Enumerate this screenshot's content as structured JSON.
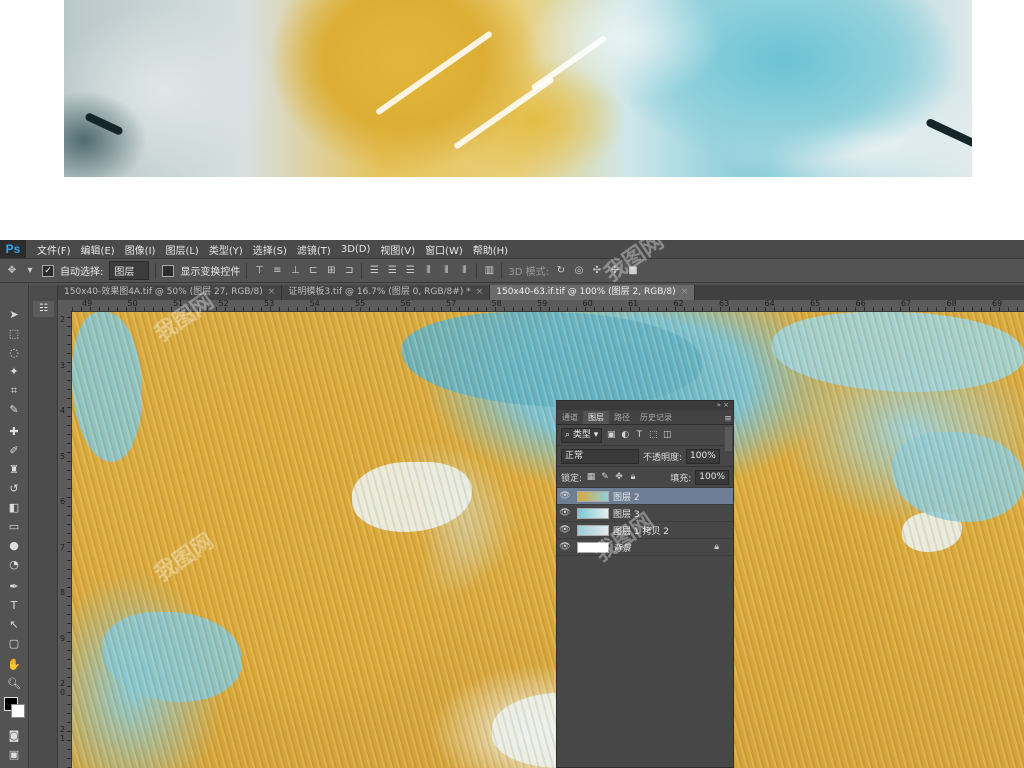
{
  "app": {
    "logo": "Ps"
  },
  "menu": [
    "文件(F)",
    "编辑(E)",
    "图像(I)",
    "图层(L)",
    "类型(Y)",
    "选择(S)",
    "滤镜(T)",
    "3D(D)",
    "视图(V)",
    "窗口(W)",
    "帮助(H)"
  ],
  "options": {
    "auto_select_label": "自动选择:",
    "auto_select_value": "图层",
    "show_transform_label": "显示变换控件",
    "mode_3d_label": "3D 模式:"
  },
  "tabs": [
    {
      "label": "150x40-效果图4A.tif @ 50% (图层 27, RGB/8)",
      "close": "×"
    },
    {
      "label": "证明模板3.tif @ 16.7% (图层 0, RGB/8#) *",
      "close": "×"
    },
    {
      "label": "150x40-63.if.tif @ 100% (图层 2, RGB/8)",
      "close": "×"
    }
  ],
  "ruler_top": [
    "49",
    "50",
    "51",
    "52",
    "53",
    "54",
    "55",
    "56",
    "57",
    "58",
    "59",
    "60",
    "61",
    "62",
    "63",
    "64",
    "65",
    "66",
    "67",
    "68",
    "69",
    "70"
  ],
  "ruler_left": [
    "2",
    "3",
    "4",
    "5",
    "6",
    "7",
    "8",
    "9",
    "2 0",
    "2 1"
  ],
  "layers_panel": {
    "tabs": [
      "通道",
      "图层",
      "路径",
      "历史记录"
    ],
    "kind_filter": "类型",
    "blend_mode": "正常",
    "opacity_label": "不透明度:",
    "opacity_value": "100%",
    "lock_label": "锁定:",
    "fill_label": "填充:",
    "fill_value": "100%",
    "layers": [
      {
        "name": "图层 2",
        "selected": true
      },
      {
        "name": "图层 3",
        "selected": false
      },
      {
        "name": "图层 1 拷贝 2",
        "selected": false
      },
      {
        "name": "背景",
        "selected": false,
        "locked": true
      }
    ]
  },
  "colors": {
    "accent": "#31a8ff",
    "selected_layer": "#6e7e95",
    "gold": "#d9a93c",
    "teal": "#6cc3d4"
  }
}
